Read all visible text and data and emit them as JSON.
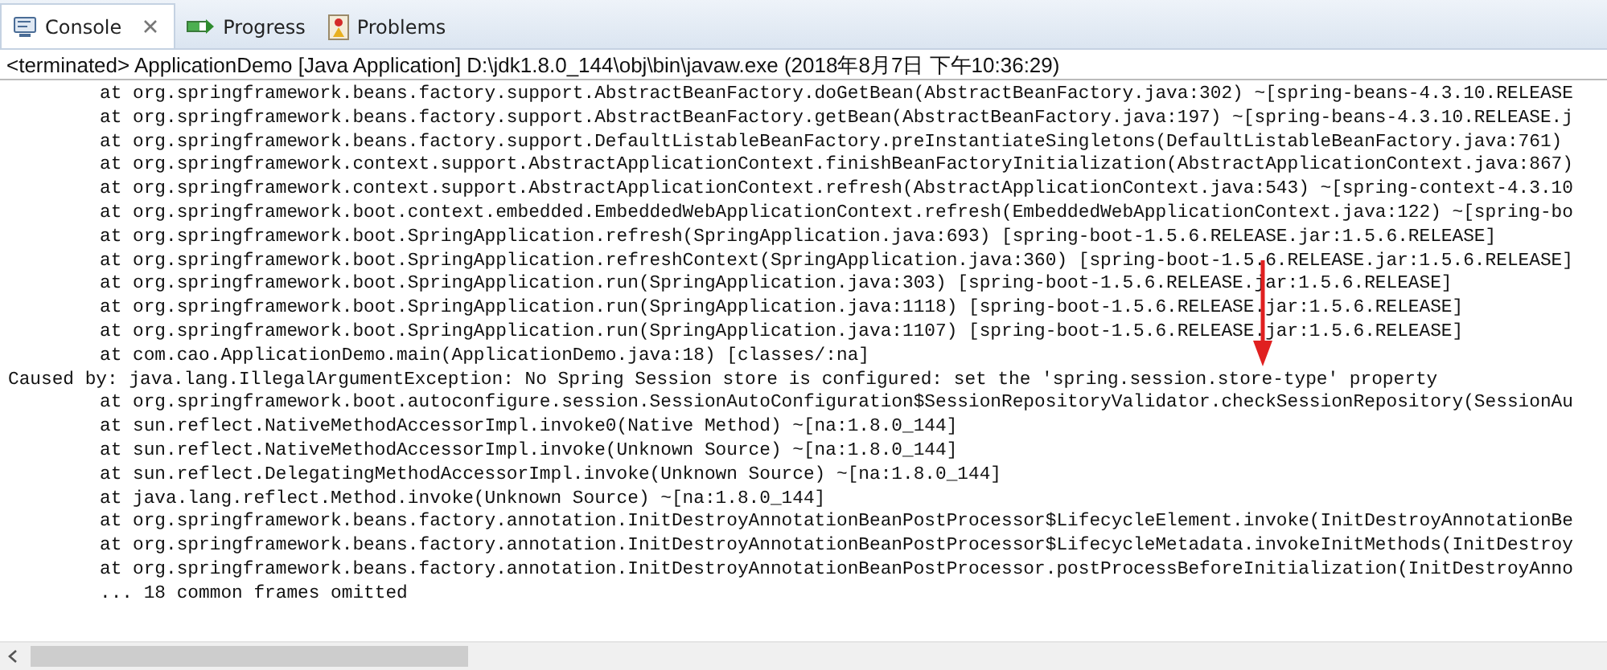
{
  "tabs": [
    {
      "label": "Console",
      "selected": true,
      "closable": true
    },
    {
      "label": "Progress",
      "selected": false,
      "closable": false
    },
    {
      "label": "Problems",
      "selected": false,
      "closable": false
    }
  ],
  "process_label": "<terminated> ApplicationDemo [Java Application] D:\\jdk1.8.0_144\\obj\\bin\\javaw.exe (2018年8月7日 下午10:36:29)",
  "console_lines": [
    {
      "text": "at org.springframework.beans.factory.support.AbstractBeanFactory.doGetBean(AbstractBeanFactory.java:302) ~[spring-beans-4.3.10.RELEASE",
      "indented": true
    },
    {
      "text": "at org.springframework.beans.factory.support.AbstractBeanFactory.getBean(AbstractBeanFactory.java:197) ~[spring-beans-4.3.10.RELEASE.j",
      "indented": true
    },
    {
      "text": "at org.springframework.beans.factory.support.DefaultListableBeanFactory.preInstantiateSingletons(DefaultListableBeanFactory.java:761)",
      "indented": true
    },
    {
      "text": "at org.springframework.context.support.AbstractApplicationContext.finishBeanFactoryInitialization(AbstractApplicationContext.java:867)",
      "indented": true
    },
    {
      "text": "at org.springframework.context.support.AbstractApplicationContext.refresh(AbstractApplicationContext.java:543) ~[spring-context-4.3.10",
      "indented": true
    },
    {
      "text": "at org.springframework.boot.context.embedded.EmbeddedWebApplicationContext.refresh(EmbeddedWebApplicationContext.java:122) ~[spring-bo",
      "indented": true
    },
    {
      "text": "at org.springframework.boot.SpringApplication.refresh(SpringApplication.java:693) [spring-boot-1.5.6.RELEASE.jar:1.5.6.RELEASE]",
      "indented": true
    },
    {
      "text": "at org.springframework.boot.SpringApplication.refreshContext(SpringApplication.java:360) [spring-boot-1.5.6.RELEASE.jar:1.5.6.RELEASE]",
      "indented": true
    },
    {
      "text": "at org.springframework.boot.SpringApplication.run(SpringApplication.java:303) [spring-boot-1.5.6.RELEASE.jar:1.5.6.RELEASE]",
      "indented": true
    },
    {
      "text": "at org.springframework.boot.SpringApplication.run(SpringApplication.java:1118) [spring-boot-1.5.6.RELEASE.jar:1.5.6.RELEASE]",
      "indented": true
    },
    {
      "text": "at org.springframework.boot.SpringApplication.run(SpringApplication.java:1107) [spring-boot-1.5.6.RELEASE.jar:1.5.6.RELEASE]",
      "indented": true
    },
    {
      "text": "at com.cao.ApplicationDemo.main(ApplicationDemo.java:18) [classes/:na]",
      "indented": true
    },
    {
      "text": "Caused by: java.lang.IllegalArgumentException: No Spring Session store is configured: set the 'spring.session.store-type' property",
      "indented": false
    },
    {
      "text": "at org.springframework.boot.autoconfigure.session.SessionAutoConfiguration$SessionRepositoryValidator.checkSessionRepository(SessionAu",
      "indented": true
    },
    {
      "text": "at sun.reflect.NativeMethodAccessorImpl.invoke0(Native Method) ~[na:1.8.0_144]",
      "indented": true
    },
    {
      "text": "at sun.reflect.NativeMethodAccessorImpl.invoke(Unknown Source) ~[na:1.8.0_144]",
      "indented": true
    },
    {
      "text": "at sun.reflect.DelegatingMethodAccessorImpl.invoke(Unknown Source) ~[na:1.8.0_144]",
      "indented": true
    },
    {
      "text": "at java.lang.reflect.Method.invoke(Unknown Source) ~[na:1.8.0_144]",
      "indented": true
    },
    {
      "text": "at org.springframework.beans.factory.annotation.InitDestroyAnnotationBeanPostProcessor$LifecycleElement.invoke(InitDestroyAnnotationBe",
      "indented": true
    },
    {
      "text": "at org.springframework.beans.factory.annotation.InitDestroyAnnotationBeanPostProcessor$LifecycleMetadata.invokeInitMethods(InitDestroy",
      "indented": true
    },
    {
      "text": "at org.springframework.beans.factory.annotation.InitDestroyAnnotationBeanPostProcessor.postProcessBeforeInitialization(InitDestroyAnno",
      "indented": true
    },
    {
      "text": "... 18 common frames omitted",
      "indented": true
    }
  ]
}
